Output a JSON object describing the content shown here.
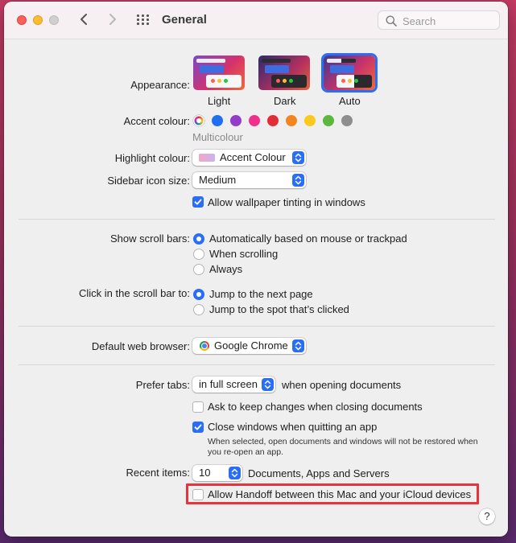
{
  "window": {
    "title": "General"
  },
  "toolbar": {
    "back_icon": "chevron-left-icon",
    "forward_icon": "chevron-right-icon",
    "grid_icon": "grid-icon",
    "search_placeholder": "Search"
  },
  "appearance": {
    "label": "Appearance:",
    "options": [
      {
        "label": "Light",
        "selected": false
      },
      {
        "label": "Dark",
        "selected": false
      },
      {
        "label": "Auto",
        "selected": true
      }
    ]
  },
  "accent": {
    "label": "Accent colour:",
    "colors": [
      "#multicolour",
      "#1f6ff2",
      "#953bc9",
      "#f1308e",
      "#e22d36",
      "#f38521",
      "#fbc81c",
      "#5cb83c",
      "#8e8e8e"
    ],
    "selected_name": "Multicolour"
  },
  "highlight": {
    "label": "Highlight colour:",
    "value": "Accent Colour"
  },
  "sidebar_icon": {
    "label": "Sidebar icon size:",
    "value": "Medium"
  },
  "wallpaper_tint": {
    "label": "Allow wallpaper tinting in windows",
    "checked": true
  },
  "scroll_bars": {
    "label": "Show scroll bars:",
    "options": [
      {
        "label": "Automatically based on mouse or trackpad",
        "selected": true
      },
      {
        "label": "When scrolling",
        "selected": false
      },
      {
        "label": "Always",
        "selected": false
      }
    ]
  },
  "scroll_click": {
    "label": "Click in the scroll bar to:",
    "options": [
      {
        "label": "Jump to the next page",
        "selected": true
      },
      {
        "label": "Jump to the spot that’s clicked",
        "selected": false
      }
    ]
  },
  "browser": {
    "label": "Default web browser:",
    "value": "Google Chrome"
  },
  "tabs": {
    "label": "Prefer tabs:",
    "value": "in full screen",
    "suffix": "when opening documents"
  },
  "ask_keep": {
    "label": "Ask to keep changes when closing documents",
    "checked": false
  },
  "close_windows": {
    "label": "Close windows when quitting an app",
    "checked": true,
    "note": "When selected, open documents and windows will not be restored when you re-open an app."
  },
  "recent": {
    "label": "Recent items:",
    "value": "10",
    "suffix": "Documents, Apps and Servers"
  },
  "handoff": {
    "label": "Allow Handoff between this Mac and your iCloud devices",
    "checked": false
  },
  "help": {
    "label": "?"
  },
  "colors": {
    "accent": "#2a6ef5",
    "highlight_outline": "#e8333c"
  }
}
